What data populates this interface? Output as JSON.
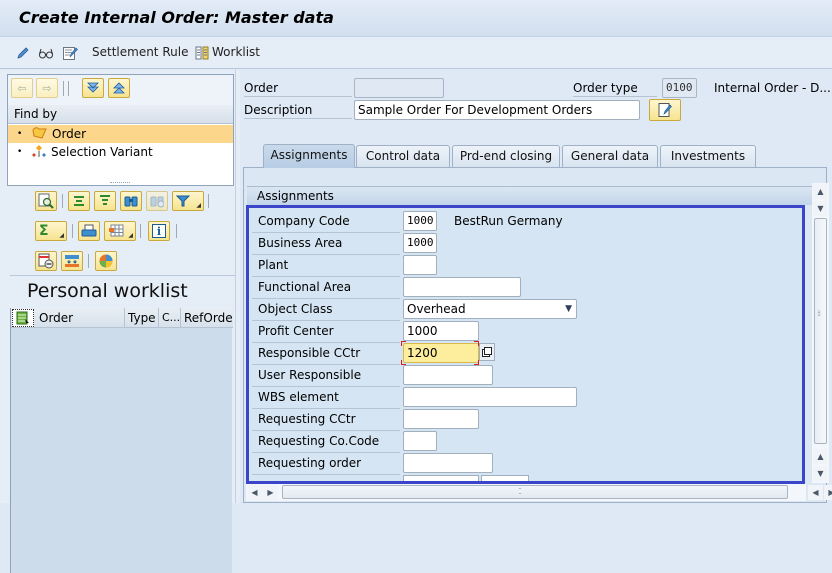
{
  "window": {
    "title": "Create Internal Order: Master data"
  },
  "toolbar": {
    "items": [
      {
        "icon": "pencil-icon",
        "label": ""
      },
      {
        "icon": "glasses-icon",
        "label": ""
      },
      {
        "icon": "edit-document-icon",
        "label": ""
      },
      {
        "icon": "",
        "label": "Settlement Rule"
      },
      {
        "icon": "worklist-icon",
        "label": "Worklist"
      }
    ]
  },
  "navigator": {
    "buttons": [
      "back-arrow-icon",
      "forward-arrow-icon",
      "expand-all-icon",
      "collapse-all-icon"
    ],
    "find_by_label": "Find by",
    "tree": [
      {
        "label": "Order",
        "icon": "order-icon",
        "selected": true
      },
      {
        "label": "Selection Variant",
        "icon": "selection-variant-icon",
        "selected": false
      }
    ]
  },
  "worklist": {
    "title": "Personal worklist",
    "toolbar_rows": [
      [
        "details-icon",
        "align-icon",
        "filter-align-icon",
        "find-icon",
        "find-next-icon",
        "filter-icon"
      ],
      [
        "sum-icon",
        "print-icon",
        "layout-icon",
        "info-icon"
      ],
      [
        "delete-row-icon",
        "export-icon",
        "chart-icon"
      ]
    ],
    "columns": [
      "Order",
      "Type",
      "C...",
      "RefOrder"
    ],
    "rows": []
  },
  "header": {
    "order_label": "Order",
    "order_value": "",
    "order_type_label": "Order type",
    "order_type_value": "0100",
    "order_type_desc": "Internal Order - D...",
    "description_label": "Description",
    "description_value": "Sample Order For Development Orders"
  },
  "tabs": [
    {
      "label": "Assignments",
      "active": true
    },
    {
      "label": "Control data",
      "active": false
    },
    {
      "label": "Prd-end closing",
      "active": false
    },
    {
      "label": "General data",
      "active": false
    },
    {
      "label": "Investments",
      "active": false
    }
  ],
  "assignments": {
    "group_title": "Assignments",
    "fields": [
      {
        "label": "Company Code",
        "value": "1000",
        "extra": "BestRun Germany"
      },
      {
        "label": "Business Area",
        "value": "1000",
        "extra": ""
      },
      {
        "label": "Plant",
        "value": "",
        "extra": ""
      },
      {
        "label": "Functional Area",
        "value": "",
        "extra": ""
      },
      {
        "label": "Object Class",
        "value": "Overhead",
        "extra": ""
      },
      {
        "label": "Profit Center",
        "value": "1000",
        "extra": ""
      },
      {
        "label": "Responsible CCtr",
        "value": "1200",
        "extra": ""
      },
      {
        "label": "User Responsible",
        "value": "",
        "extra": ""
      },
      {
        "label": "WBS element",
        "value": "",
        "extra": ""
      },
      {
        "label": "Requesting CCtr",
        "value": "",
        "extra": ""
      },
      {
        "label": "Requesting Co.Code",
        "value": "",
        "extra": ""
      },
      {
        "label": "Requesting order",
        "value": "",
        "extra": ""
      }
    ]
  },
  "colors": {
    "highlight_border": "#3b45c9",
    "selected_tree_item": "#fbd68b",
    "focus_field": "#fdee9e",
    "focus_bracket": "#d31f1f"
  }
}
